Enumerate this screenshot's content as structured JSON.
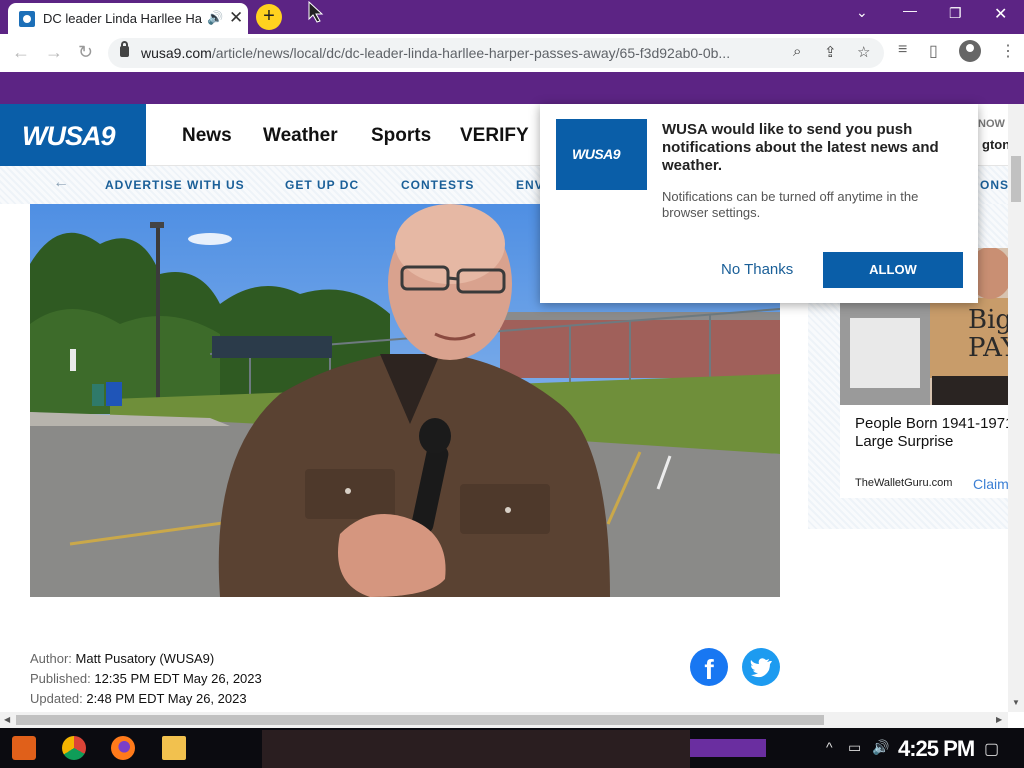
{
  "browser": {
    "tab_title": "DC leader Linda Harllee Ha",
    "url_host": "wusa9.com",
    "url_path": "/article/news/local/dc/dc-leader-linda-harllee-harper-passes-away/65-f3d92ab0-0b..."
  },
  "site": {
    "logo_text": "WUSA9",
    "nav": [
      "News",
      "Weather",
      "Sports",
      "VERIFY"
    ],
    "now_label": "NOW",
    "right_fragment": "gton",
    "subnav": [
      "ADVERTISE WITH US",
      "GET UP DC",
      "CONTESTS",
      "ENV"
    ],
    "subnav_right_fragment": "ONS"
  },
  "popup": {
    "title": "WUSA would like to send you push notifications about the latest news and weather.",
    "body": "Notifications can be turned off anytime in the browser settings.",
    "no_thanks": "No Thanks",
    "allow": "ALLOW",
    "logo_text": "WUSA9"
  },
  "ad": {
    "sign_text": "Big PAY",
    "headline_line1": "People Born 1941-1971",
    "headline_line2": "Large Surprise",
    "source": "TheWalletGuru.com",
    "cta": "Claim"
  },
  "article": {
    "author_label": "Author:",
    "author": "Matt Pusatory (WUSA9)",
    "published_label": "Published:",
    "published": "12:35 PM EDT May 26, 2023",
    "updated_label": "Updated:",
    "updated": "2:48 PM EDT May 26, 2023"
  },
  "taskbar": {
    "clock": "4:25 PM"
  },
  "colors": {
    "chrome_purple": "#5c2484",
    "brand_blue": "#0a5ea8",
    "link_blue": "#1a5f98"
  }
}
